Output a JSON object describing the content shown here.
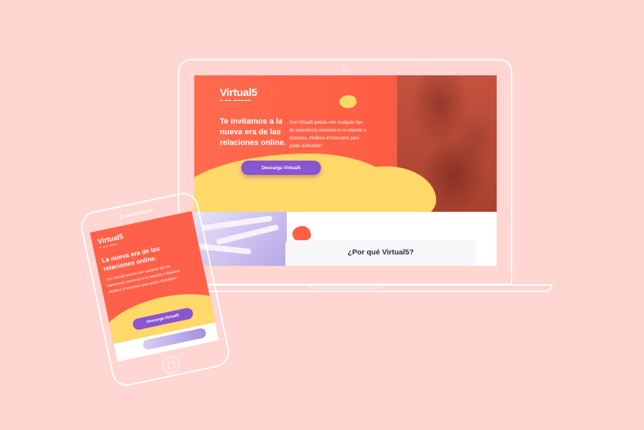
{
  "desktop": {
    "logo": "Virtual5",
    "logo_tagline": "▬ ▬▬ ▬▬▬▬▬",
    "hero_title": "Te invitamos a la nueva era de las relaciones online.",
    "hero_text": "Con Virtual5 podrás vivir cualquier tipo de experiencia sensorial en tu relación a distancia. ¡Rellena el formulario para poder disfrutarlo!",
    "cta_label": "Descarga Virtual5",
    "section_title": "¿Por qué Virtual5?"
  },
  "mobile": {
    "logo": "Virtual5",
    "logo_tagline": "▬ ▬▬ ▬▬▬",
    "hero_title": "La nueva era de las relaciones online.",
    "hero_text": "Con Virtual5 podrás vivir cualquier tipo de experiencia sensorial en tu relación a distancia. ¡Rellena el formulario para poder disfrutarlo!",
    "cta_label": "Descarga Virtual5"
  },
  "colors": {
    "background": "#ffd6d2",
    "hero_red": "#ff5f45",
    "accent_yellow": "#ffd86a",
    "button_purple": "#8a55d0"
  }
}
